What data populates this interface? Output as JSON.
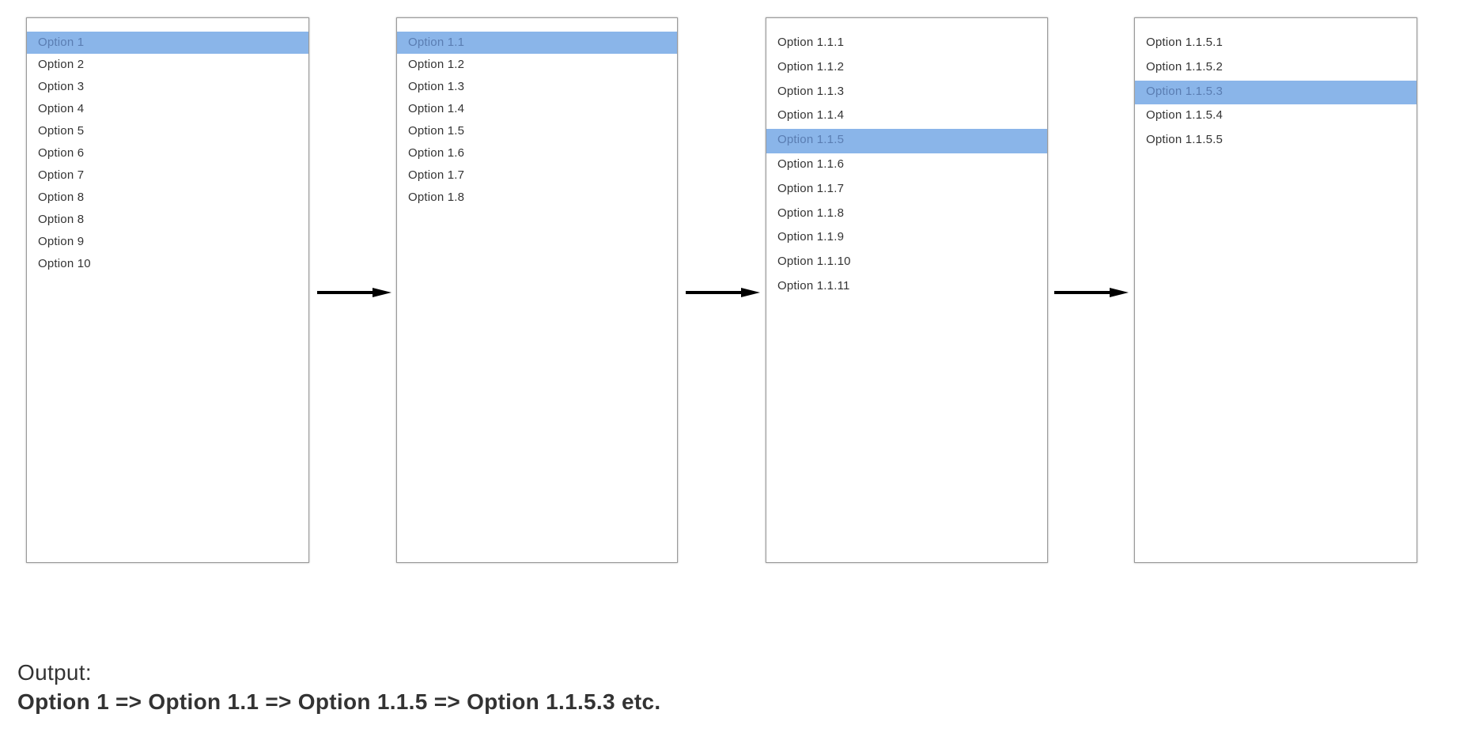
{
  "colors": {
    "selection_background": "#8ab5e9",
    "selection_text": "#5a7db2",
    "text": "#333333",
    "panel_border": "#9a9a9a",
    "arrow": "#000000"
  },
  "panels": [
    {
      "name": "level-1",
      "selected_index": 0,
      "items": [
        "Option 1",
        "Option 2",
        "Option 3",
        "Option 4",
        "Option 5",
        "Option 6",
        "Option 7",
        "Option 8",
        "Option 8",
        "Option 9",
        "Option 10"
      ]
    },
    {
      "name": "level-2",
      "selected_index": 0,
      "items": [
        "Option 1.1",
        "Option 1.2",
        "Option 1.3",
        "Option 1.4",
        "Option 1.5",
        "Option 1.6",
        "Option 1.7",
        "Option 1.8"
      ]
    },
    {
      "name": "level-3",
      "selected_index": 4,
      "items": [
        "Option 1.1.1",
        "Option 1.1.2",
        "Option 1.1.3",
        "Option 1.1.4",
        "Option 1.1.5",
        "Option 1.1.6",
        "Option 1.1.7",
        "Option 1.1.8",
        "Option 1.1.9",
        "Option 1.1.10",
        "Option 1.1.11"
      ]
    },
    {
      "name": "level-4",
      "selected_index": 2,
      "items": [
        "Option 1.1.5.1",
        "Option 1.1.5.2",
        "Option 1.1.5.3",
        "Option 1.1.5.4",
        "Option 1.1.5.5"
      ]
    }
  ],
  "arrows": [
    {
      "icon": "arrow-right-icon"
    },
    {
      "icon": "arrow-right-icon"
    },
    {
      "icon": "arrow-right-icon"
    }
  ],
  "output": {
    "label": "Output:",
    "path": "Option 1 => Option 1.1 => Option 1.1.5 => Option 1.1.5.3 etc."
  }
}
